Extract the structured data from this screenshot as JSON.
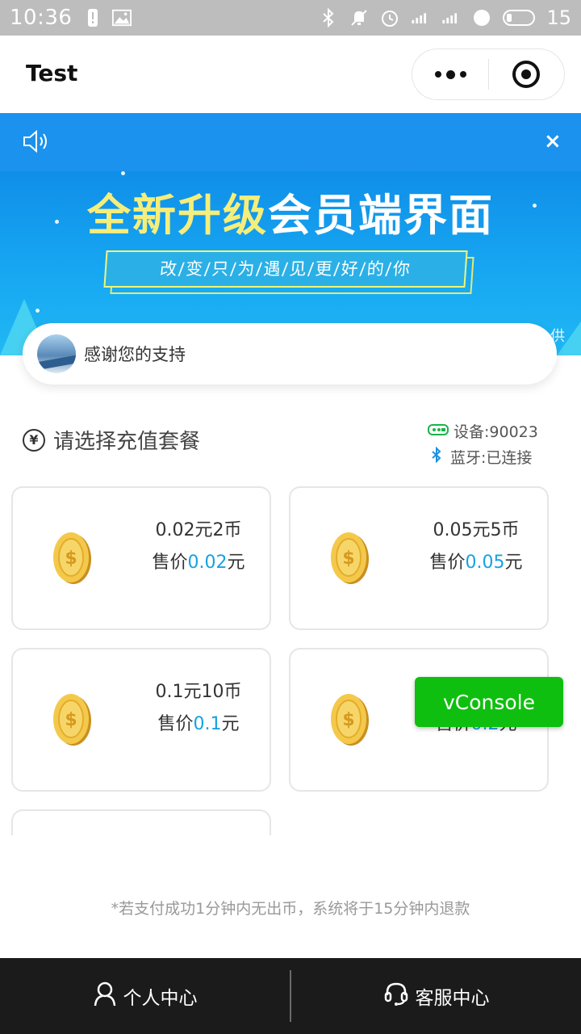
{
  "status_bar": {
    "time": "10:36",
    "battery": "15"
  },
  "nav": {
    "title": "Test"
  },
  "notice": {
    "close": "×"
  },
  "banner": {
    "headline_part1": "全新升级",
    "headline_part2": "会员端界面",
    "tagline": "改/变/只/为/遇/见/更/好/的/你",
    "edge_text": "供"
  },
  "user": {
    "message": "感谢您的支持"
  },
  "section": {
    "yen_symbol": "¥",
    "title": "请选择充值套餐"
  },
  "device": {
    "label": "设备:90023"
  },
  "bluetooth": {
    "label": "蓝牙:已连接"
  },
  "packages": [
    {
      "name": "0.02元2币",
      "price_prefix": "售价",
      "price": "0.02",
      "price_unit": "元"
    },
    {
      "name": "0.05元5币",
      "price_prefix": "售价",
      "price": "0.05",
      "price_unit": "元"
    },
    {
      "name": "0.1元10币",
      "price_prefix": "售价",
      "price": "0.1",
      "price_unit": "元"
    },
    {
      "name": "",
      "price_prefix": "售价",
      "price": "0.2",
      "price_unit": "元"
    }
  ],
  "vconsole": {
    "label": "vConsole"
  },
  "footer_note": "*若支付成功1分钟内无出币，系统将于15分钟内退款",
  "tabbar": {
    "personal": "个人中心",
    "service": "客服中心"
  }
}
